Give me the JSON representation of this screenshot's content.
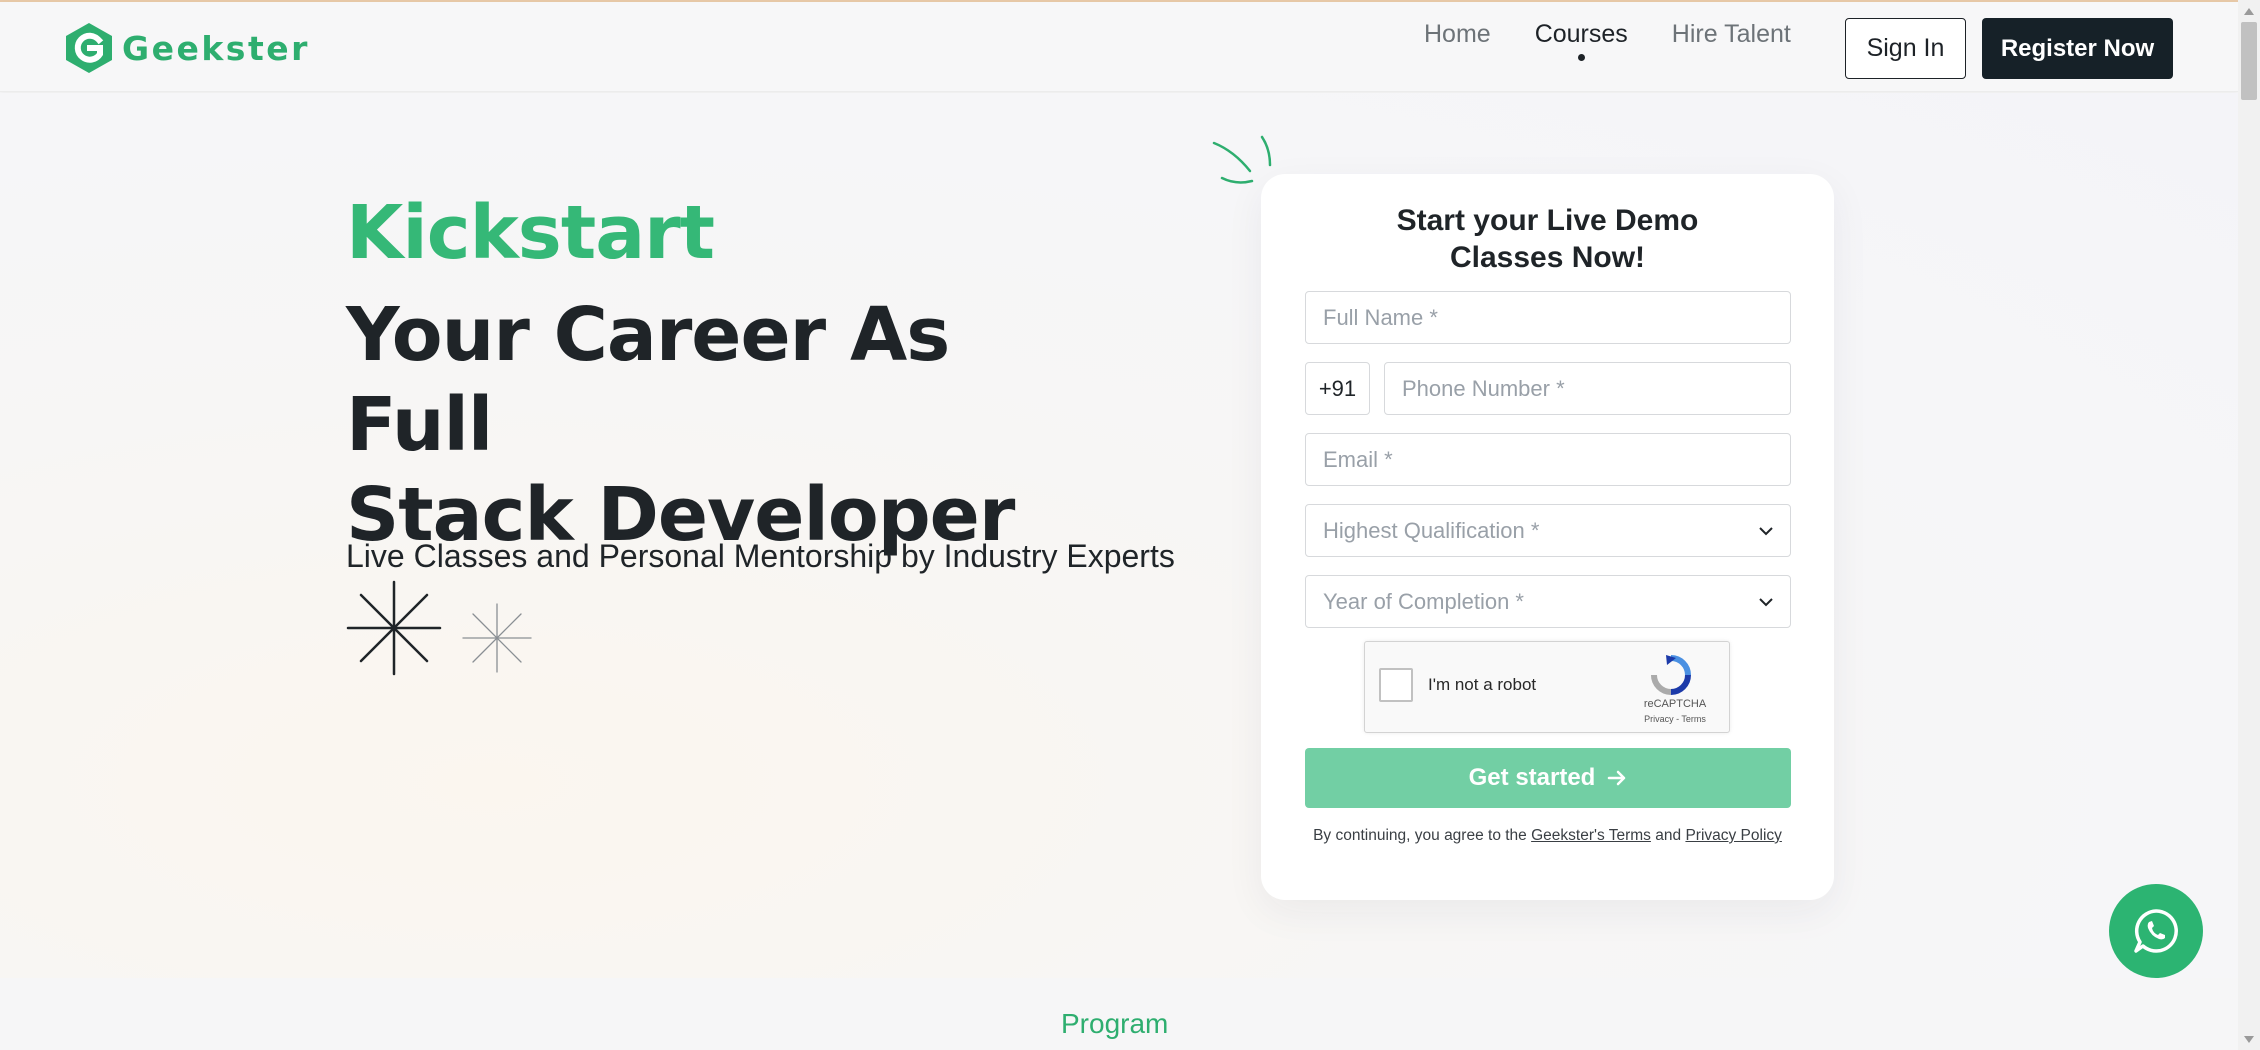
{
  "brand": {
    "name": "Geekster",
    "color": "#2eae6f"
  },
  "nav": {
    "links": [
      {
        "label": "Home",
        "active": false
      },
      {
        "label": "Courses",
        "active": true
      },
      {
        "label": "Hire Talent",
        "active": false
      }
    ],
    "sign_in": "Sign In",
    "register": "Register Now"
  },
  "hero": {
    "kicker": "Kickstart",
    "title_line1": "Your Career As Full",
    "title_line2": "Stack Developer",
    "subtitle": "Live Classes and Personal Mentorship by Industry Experts"
  },
  "form": {
    "title_line1": "Start your Live Demo",
    "title_line2": "Classes Now!",
    "full_name_placeholder": "Full Name *",
    "country_code": "+91",
    "phone_placeholder": "Phone Number *",
    "email_placeholder": "Email *",
    "qualification_placeholder": "Highest Qualification *",
    "year_placeholder": "Year of Completion *",
    "captcha_label": "I'm not a robot",
    "captcha_brand": "reCAPTCHA",
    "captcha_links": "Privacy - Terms",
    "submit": "Get started",
    "terms_prefix": "By continuing, you agree to the",
    "terms_link": "Geekster's Terms",
    "terms_and": "and",
    "privacy_link": "Privacy Policy"
  },
  "section_label": "Program",
  "colors": {
    "accent": "#35b877",
    "dark": "#162128",
    "button_disabled": "#72cfa4",
    "whatsapp": "#2cb472"
  }
}
